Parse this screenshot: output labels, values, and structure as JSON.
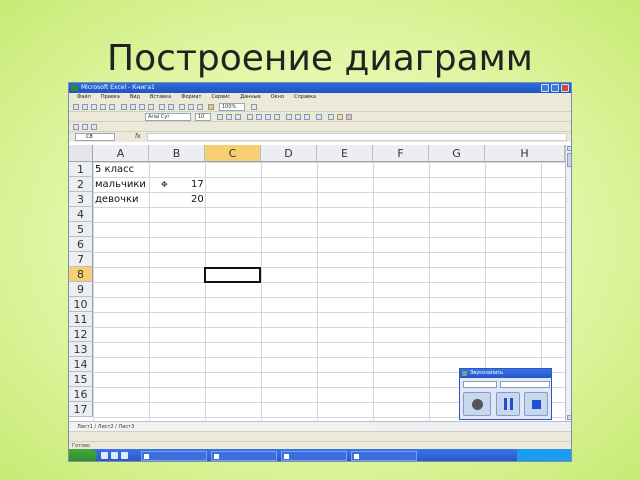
{
  "slide": {
    "title": "Построение диаграмм"
  },
  "window": {
    "title": "Microsoft Excel - Книга1"
  },
  "menu": [
    "Файл",
    "Правка",
    "Вид",
    "Вставка",
    "Формат",
    "Сервис",
    "Данные",
    "Окно",
    "Справка"
  ],
  "toolbar": {
    "font_name": "Arial Cyr",
    "font_size": "10",
    "zoom": "100%"
  },
  "namebox": {
    "value": "C8"
  },
  "formula_bar": {
    "fx": "fx"
  },
  "columns": [
    "A",
    "B",
    "C",
    "D",
    "E",
    "F",
    "G",
    "H"
  ],
  "rows": [
    "1",
    "2",
    "3",
    "4",
    "5",
    "6",
    "7",
    "8",
    "9",
    "10",
    "11",
    "12",
    "13",
    "14",
    "15",
    "16",
    "17"
  ],
  "active_cell": {
    "column": "C",
    "row": "8"
  },
  "cells": {
    "a1": "5 класс",
    "a2": "мальчики",
    "b2": "17",
    "a3": "девочки",
    "b3": "20"
  },
  "sheet_tabs": {
    "label": "Лист1 / Лист2 / Лист3"
  },
  "statusbar": {
    "text": "Готово"
  },
  "recorder": {
    "title": "Звукозапись"
  },
  "colors": {
    "active_header": "#f6cf72",
    "slide_bg": "#d8f08c",
    "taskbar": "#2554c7"
  }
}
